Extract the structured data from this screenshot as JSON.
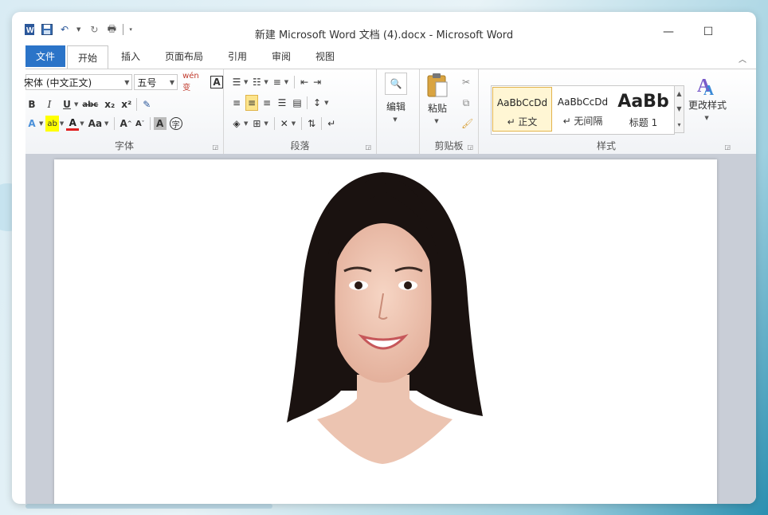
{
  "window": {
    "title": "新建 Microsoft Word 文档 (4).docx  -  Microsoft Word"
  },
  "controls": {
    "minimize": "—",
    "maximize": "☐"
  },
  "tabs": {
    "file": "文件",
    "items": [
      {
        "label": "开始",
        "active": true
      },
      {
        "label": "插入"
      },
      {
        "label": "页面布局"
      },
      {
        "label": "引用"
      },
      {
        "label": "审阅"
      },
      {
        "label": "视图"
      }
    ]
  },
  "font_group": {
    "font_name": "宋体 (中文正文)",
    "font_size": "五号",
    "label": "字体",
    "phonetic": "wén 变",
    "border_char": "A",
    "bold": "B",
    "italic": "I",
    "underline": "U",
    "strike": "abc",
    "subscript": "x₂",
    "superscript": "x²",
    "case": "Aa",
    "grow": "A",
    "shrink": "A",
    "shade_char": "A",
    "enclose_char": "字"
  },
  "paragraph_group": {
    "label": "段落"
  },
  "edit_group": {
    "label": "编辑"
  },
  "clipboard_group": {
    "label": "剪贴板",
    "paste": "粘贴"
  },
  "styles_group": {
    "label": "样式",
    "change_styles": "更改样式",
    "items": [
      {
        "preview": "AaBbCcDd",
        "name": "↵ 正文",
        "selected": true
      },
      {
        "preview": "AaBbCcDd",
        "name": "↵ 无间隔"
      },
      {
        "preview": "AaBb",
        "name": "标题 1"
      }
    ]
  },
  "colors": {
    "accent": "#2b74c8",
    "highlight_selected": "#fce48b",
    "doc_background": "#c9ced7"
  }
}
